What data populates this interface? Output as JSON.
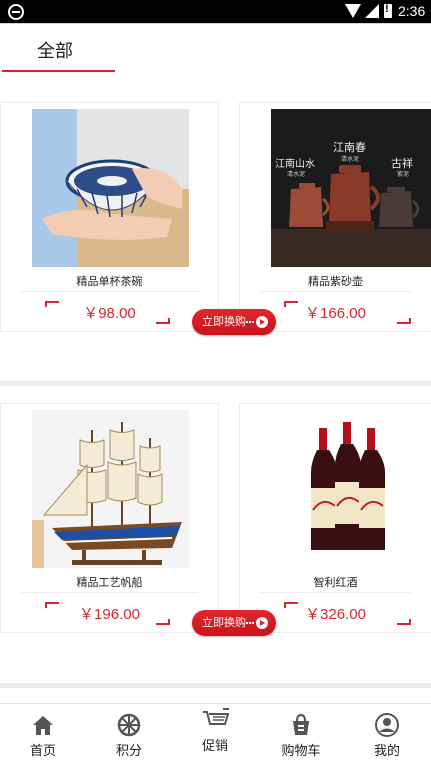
{
  "status_bar": {
    "time": "2:36"
  },
  "tabs": {
    "active": "全部"
  },
  "products": [
    {
      "name": "精品单杯茶碗",
      "price": "￥98.00",
      "image": "tea-bowl"
    },
    {
      "name": "精品紫砂壶",
      "price": "￥166.00",
      "image": "purple-clay-teapots",
      "image_text": {
        "t1": "江南春",
        "t1s": "清水泥",
        "t2": "江南山水",
        "t2s": "清水泥",
        "t3": "古祥",
        "t3s": "紫泥"
      }
    },
    {
      "name": "精品工艺帆船",
      "price": "￥196.00",
      "image": "sailing-ship-model"
    },
    {
      "name": "智利红酒",
      "price": "￥326.00",
      "image": "chile-red-wine"
    }
  ],
  "exchange_button": "立即换购",
  "bottom_nav": [
    {
      "label": "首页",
      "icon": "home-icon"
    },
    {
      "label": "积分",
      "icon": "points-icon"
    },
    {
      "label": "促销",
      "icon": "cart-promo-icon"
    },
    {
      "label": "购物车",
      "icon": "shopping-bag-icon"
    },
    {
      "label": "我的",
      "icon": "profile-icon"
    }
  ],
  "colors": {
    "accent": "#d8262c",
    "tab_underline": "#e02020"
  }
}
